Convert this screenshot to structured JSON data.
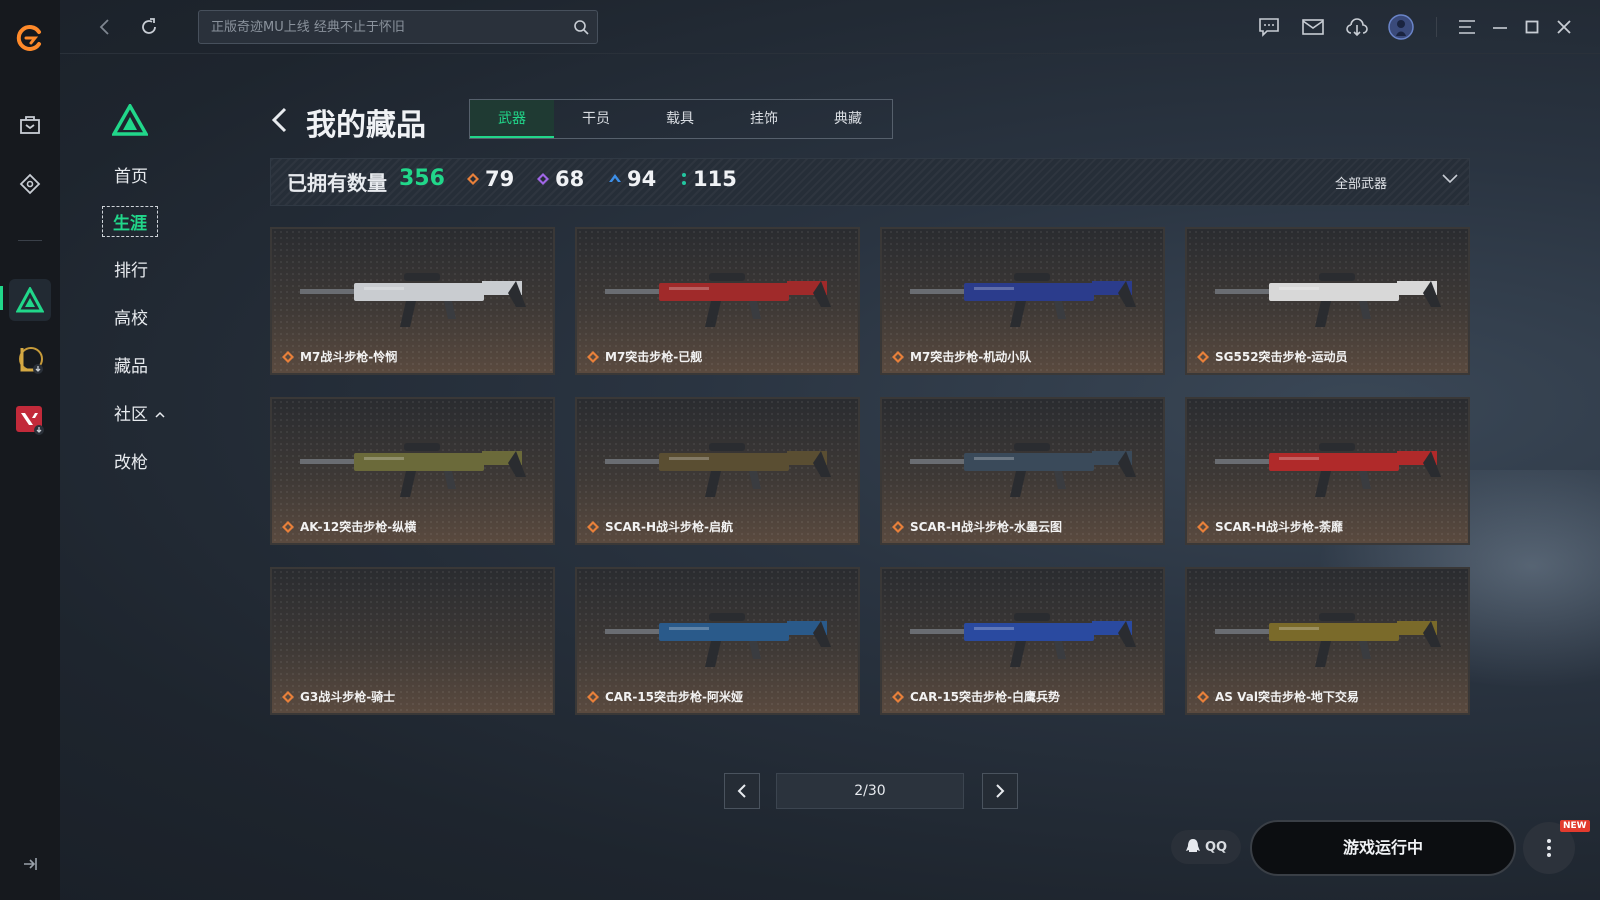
{
  "app": {
    "brand_color": "#ff8a2a",
    "accent": "#21d78a"
  },
  "search": {
    "placeholder": "正版奇迹MU上线 经典不止于怀旧"
  },
  "leftbar": {
    "icons": [
      "app-logo-icon",
      "bag-icon",
      "ticket-icon",
      "delta-game-icon",
      "lol-game-icon",
      "valorant-game-icon",
      "collapse-icon"
    ]
  },
  "sidenav": {
    "items": [
      {
        "label": "首页"
      },
      {
        "label": "生涯"
      },
      {
        "label": "排行"
      },
      {
        "label": "高校"
      },
      {
        "label": "藏品"
      },
      {
        "label": "社区"
      },
      {
        "label": "改枪"
      }
    ]
  },
  "page": {
    "title": "我的藏品"
  },
  "tabs": [
    {
      "label": "武器"
    },
    {
      "label": "干员"
    },
    {
      "label": "载具"
    },
    {
      "label": "挂饰"
    },
    {
      "label": "典藏"
    }
  ],
  "stats": {
    "owned_label": "已拥有数量",
    "owned_total": "356",
    "counts": [
      {
        "value": "79",
        "color": "#e8803a"
      },
      {
        "value": "68",
        "color": "#a066e6"
      },
      {
        "value": "94",
        "color": "#3d8fe8"
      },
      {
        "value": "115",
        "color": "#23c6a0"
      }
    ],
    "filter_label": "全部武器"
  },
  "items": [
    {
      "name": "M7战斗步枪-怜悯",
      "color": "#c9ccd0"
    },
    {
      "name": "M7突击步枪-已舰",
      "color": "#a02a2a"
    },
    {
      "name": "M7突击步枪-机动小队",
      "color": "#2b3c8c"
    },
    {
      "name": "SG552突击步枪-运动员",
      "color": "#d8d8d8"
    },
    {
      "name": "AK-12突击步枪-纵横",
      "color": "#6b6a3a"
    },
    {
      "name": "SCAR-H战斗步枪-启航",
      "color": "#5a4e32"
    },
    {
      "name": "SCAR-H战斗步枪-水墨云图",
      "color": "#3a4a5a"
    },
    {
      "name": "SCAR-H战斗步枪-荼靡",
      "color": "#b02a2a"
    },
    {
      "name": "G3战斗步枪-骑士",
      "color": ""
    },
    {
      "name": "CAR-15突击步枪-阿米娅",
      "color": "#2a5a8a"
    },
    {
      "name": "CAR-15突击步枪-白鹰兵势",
      "color": "#2a4aa0"
    },
    {
      "name": "AS Val突击步枪-地下交易",
      "color": "#7a6a2a"
    }
  ],
  "pagination": {
    "text": "2/30"
  },
  "bottom": {
    "qq_label": "QQ",
    "status_label": "游戏运行中",
    "new_badge": "NEW"
  }
}
